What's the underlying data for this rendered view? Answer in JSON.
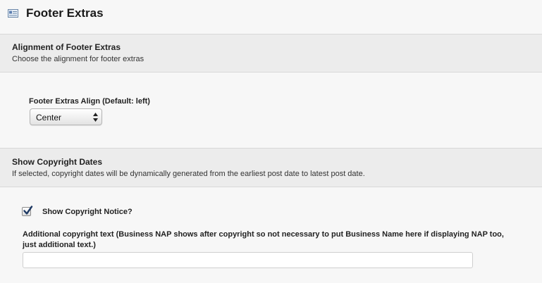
{
  "header": {
    "title": "Footer Extras",
    "icon": "settings-panel-icon"
  },
  "alignment_section": {
    "title": "Alignment of Footer Extras",
    "description": "Choose the alignment for footer extras",
    "field_label": "Footer Extras Align (Default: left)",
    "selected_value": "Center"
  },
  "copyright_section": {
    "title": "Show Copyright Dates",
    "description": "If selected, copyright dates will be dynamically generated from the earliest post date to latest post date.",
    "checkbox_label": "Show Copyright Notice?",
    "checkbox_checked": true,
    "text_label_line1": "Additional copyright text (Business NAP shows after copyright so not necessary to put Business Name here if displaying NAP too,",
    "text_label_line2": "just additional text.)",
    "text_value": ""
  },
  "colors": {
    "section_bg": "#ececec",
    "page_bg": "#f7f7f7",
    "checkmark": "#1f3a64"
  }
}
